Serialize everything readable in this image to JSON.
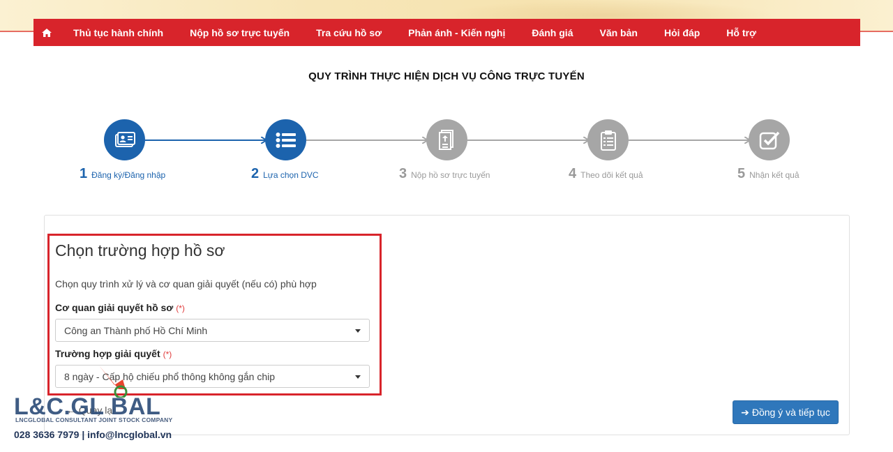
{
  "nav": {
    "home_icon": "home-icon",
    "items": [
      "Thủ tục hành chính",
      "Nộp hồ sơ trực tuyến",
      "Tra cứu hồ sơ",
      "Phản ánh - Kiến nghị",
      "Đánh giá",
      "Văn bản",
      "Hỏi đáp",
      "Hỗ trợ"
    ]
  },
  "title": "QUY TRÌNH THỰC HIỆN DỊCH VỤ CÔNG TRỰC TUYẾN",
  "steps": [
    {
      "num": "1",
      "label": "Đăng ký/Đăng nhập",
      "icon": "id-card-icon",
      "state": "active"
    },
    {
      "num": "2",
      "label": "Lựa chọn DVC",
      "icon": "list-icon",
      "state": "active"
    },
    {
      "num": "3",
      "label": "Nộp hồ sơ trực tuyến",
      "icon": "upload-document-icon",
      "state": "inactive"
    },
    {
      "num": "4",
      "label": "Theo dõi kết quả",
      "icon": "clipboard-list-icon",
      "state": "inactive"
    },
    {
      "num": "5",
      "label": "Nhận kết quả",
      "icon": "check-square-icon",
      "state": "inactive"
    }
  ],
  "form": {
    "heading": "Chọn trường hợp hồ sơ",
    "subheading": "Chọn quy trình xử lý và cơ quan giải quyết (nếu có) phù hợp",
    "agency_label": "Cơ quan giải quyết hồ sơ",
    "agency_value": "Công an Thành phố Hồ Chí Minh",
    "case_label": "Trường hợp giải quyết",
    "case_value": "8 ngày - Cấp hộ chiếu phổ thông không gắn chip",
    "required_mark": "(*)"
  },
  "back_label": "Quay lại",
  "continue_label": "Đồng ý và tiếp tục",
  "watermark": {
    "brand": "L&C.GL BAL",
    "company": "LNCGLOBAL CONSULTANT JOINT STOCK COMPANY",
    "contact": "028 3636 7979 | info@lncglobal.vn"
  },
  "colors": {
    "nav_red": "#d8242b",
    "step_active": "#1c63ad",
    "step_inactive": "#a6a6a6",
    "button_blue": "#2f77bb"
  }
}
